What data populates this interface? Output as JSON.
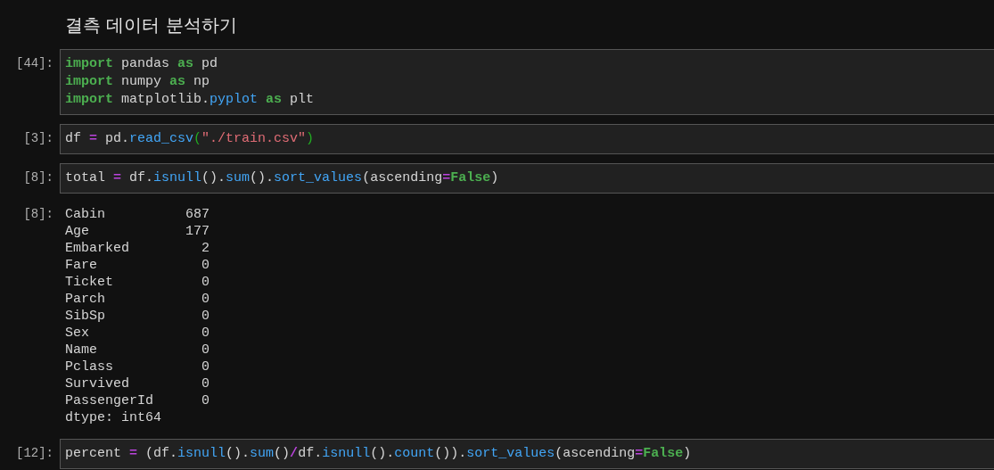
{
  "heading": "결측 데이터 분석하기",
  "cells": [
    {
      "kind": "code",
      "prompt": "[44]:",
      "lines": [
        [
          {
            "text": "import",
            "kind": "keyword"
          },
          {
            "text": " pandas ",
            "kind": "plain"
          },
          {
            "text": "as",
            "kind": "keyword"
          },
          {
            "text": " pd",
            "kind": "plain"
          }
        ],
        [
          {
            "text": "import",
            "kind": "keyword"
          },
          {
            "text": " numpy ",
            "kind": "plain"
          },
          {
            "text": "as",
            "kind": "keyword"
          },
          {
            "text": " np",
            "kind": "plain"
          }
        ],
        [
          {
            "text": "import",
            "kind": "keyword"
          },
          {
            "text": " matplotlib.",
            "kind": "plain"
          },
          {
            "text": "pyplot",
            "kind": "attr"
          },
          {
            "text": " as",
            "kind": "keyword"
          },
          {
            "text": " plt",
            "kind": "plain"
          }
        ]
      ]
    },
    {
      "kind": "code",
      "prompt": "[3]:",
      "lines": [
        [
          {
            "text": "df ",
            "kind": "plain"
          },
          {
            "text": "=",
            "kind": "operator"
          },
          {
            "text": " pd.",
            "kind": "plain"
          },
          {
            "text": "read_csv",
            "kind": "attr"
          },
          {
            "text": "(",
            "kind": "bracket"
          },
          {
            "text": "\"./train.csv\"",
            "kind": "string"
          },
          {
            "text": ")",
            "kind": "bracket"
          }
        ]
      ]
    },
    {
      "kind": "code",
      "prompt": "[8]:",
      "lines": [
        [
          {
            "text": "total ",
            "kind": "plain"
          },
          {
            "text": "=",
            "kind": "operator"
          },
          {
            "text": " df.",
            "kind": "plain"
          },
          {
            "text": "isnull",
            "kind": "attr"
          },
          {
            "text": "().",
            "kind": "plain"
          },
          {
            "text": "sum",
            "kind": "attr"
          },
          {
            "text": "().",
            "kind": "plain"
          },
          {
            "text": "sort_values",
            "kind": "attr"
          },
          {
            "text": "(ascending",
            "kind": "plain"
          },
          {
            "text": "=",
            "kind": "operator"
          },
          {
            "text": "False",
            "kind": "keyword"
          },
          {
            "text": ")",
            "kind": "plain"
          }
        ]
      ]
    },
    {
      "kind": "output",
      "prompt": "[8]:",
      "lines": [
        "Cabin          687",
        "Age            177",
        "Embarked         2",
        "Fare             0",
        "Ticket           0",
        "Parch            0",
        "SibSp            0",
        "Sex              0",
        "Name             0",
        "Pclass           0",
        "Survived         0",
        "PassengerId      0",
        "dtype: int64"
      ]
    },
    {
      "kind": "code",
      "prompt": "[12]:",
      "lines": [
        [
          {
            "text": "percent ",
            "kind": "plain"
          },
          {
            "text": "=",
            "kind": "operator"
          },
          {
            "text": " (df.",
            "kind": "plain"
          },
          {
            "text": "isnull",
            "kind": "attr"
          },
          {
            "text": "().",
            "kind": "plain"
          },
          {
            "text": "sum",
            "kind": "attr"
          },
          {
            "text": "()",
            "kind": "plain"
          },
          {
            "text": "/",
            "kind": "operator"
          },
          {
            "text": "df.",
            "kind": "plain"
          },
          {
            "text": "isnull",
            "kind": "attr"
          },
          {
            "text": "().",
            "kind": "plain"
          },
          {
            "text": "count",
            "kind": "attr"
          },
          {
            "text": "()).",
            "kind": "plain"
          },
          {
            "text": "sort_values",
            "kind": "attr"
          },
          {
            "text": "(ascending",
            "kind": "plain"
          },
          {
            "text": "=",
            "kind": "operator"
          },
          {
            "text": "False",
            "kind": "keyword"
          },
          {
            "text": ")",
            "kind": "plain"
          }
        ]
      ]
    }
  ]
}
